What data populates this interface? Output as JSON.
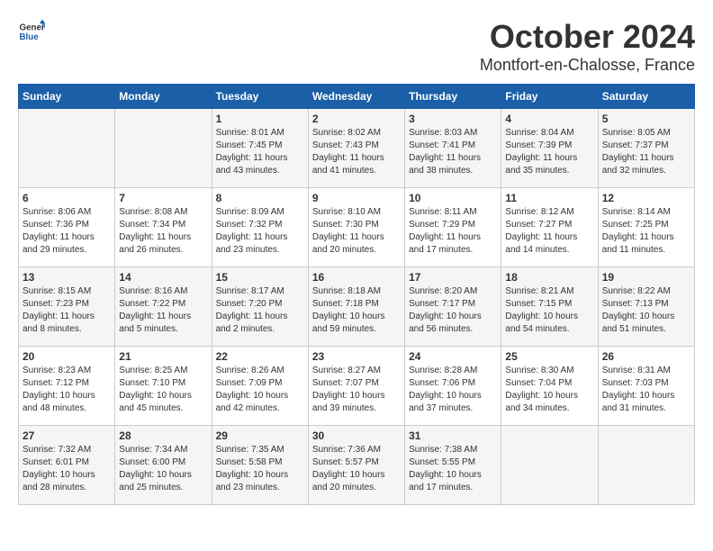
{
  "header": {
    "logo": {
      "general": "General",
      "blue": "Blue"
    },
    "title": "October 2024",
    "location": "Montfort-en-Chalosse, France"
  },
  "days_of_week": [
    "Sunday",
    "Monday",
    "Tuesday",
    "Wednesday",
    "Thursday",
    "Friday",
    "Saturday"
  ],
  "weeks": [
    [
      {
        "day": "",
        "sunrise": "",
        "sunset": "",
        "daylight": ""
      },
      {
        "day": "",
        "sunrise": "",
        "sunset": "",
        "daylight": ""
      },
      {
        "day": "1",
        "sunrise": "Sunrise: 8:01 AM",
        "sunset": "Sunset: 7:45 PM",
        "daylight": "Daylight: 11 hours and 43 minutes."
      },
      {
        "day": "2",
        "sunrise": "Sunrise: 8:02 AM",
        "sunset": "Sunset: 7:43 PM",
        "daylight": "Daylight: 11 hours and 41 minutes."
      },
      {
        "day": "3",
        "sunrise": "Sunrise: 8:03 AM",
        "sunset": "Sunset: 7:41 PM",
        "daylight": "Daylight: 11 hours and 38 minutes."
      },
      {
        "day": "4",
        "sunrise": "Sunrise: 8:04 AM",
        "sunset": "Sunset: 7:39 PM",
        "daylight": "Daylight: 11 hours and 35 minutes."
      },
      {
        "day": "5",
        "sunrise": "Sunrise: 8:05 AM",
        "sunset": "Sunset: 7:37 PM",
        "daylight": "Daylight: 11 hours and 32 minutes."
      }
    ],
    [
      {
        "day": "6",
        "sunrise": "Sunrise: 8:06 AM",
        "sunset": "Sunset: 7:36 PM",
        "daylight": "Daylight: 11 hours and 29 minutes."
      },
      {
        "day": "7",
        "sunrise": "Sunrise: 8:08 AM",
        "sunset": "Sunset: 7:34 PM",
        "daylight": "Daylight: 11 hours and 26 minutes."
      },
      {
        "day": "8",
        "sunrise": "Sunrise: 8:09 AM",
        "sunset": "Sunset: 7:32 PM",
        "daylight": "Daylight: 11 hours and 23 minutes."
      },
      {
        "day": "9",
        "sunrise": "Sunrise: 8:10 AM",
        "sunset": "Sunset: 7:30 PM",
        "daylight": "Daylight: 11 hours and 20 minutes."
      },
      {
        "day": "10",
        "sunrise": "Sunrise: 8:11 AM",
        "sunset": "Sunset: 7:29 PM",
        "daylight": "Daylight: 11 hours and 17 minutes."
      },
      {
        "day": "11",
        "sunrise": "Sunrise: 8:12 AM",
        "sunset": "Sunset: 7:27 PM",
        "daylight": "Daylight: 11 hours and 14 minutes."
      },
      {
        "day": "12",
        "sunrise": "Sunrise: 8:14 AM",
        "sunset": "Sunset: 7:25 PM",
        "daylight": "Daylight: 11 hours and 11 minutes."
      }
    ],
    [
      {
        "day": "13",
        "sunrise": "Sunrise: 8:15 AM",
        "sunset": "Sunset: 7:23 PM",
        "daylight": "Daylight: 11 hours and 8 minutes."
      },
      {
        "day": "14",
        "sunrise": "Sunrise: 8:16 AM",
        "sunset": "Sunset: 7:22 PM",
        "daylight": "Daylight: 11 hours and 5 minutes."
      },
      {
        "day": "15",
        "sunrise": "Sunrise: 8:17 AM",
        "sunset": "Sunset: 7:20 PM",
        "daylight": "Daylight: 11 hours and 2 minutes."
      },
      {
        "day": "16",
        "sunrise": "Sunrise: 8:18 AM",
        "sunset": "Sunset: 7:18 PM",
        "daylight": "Daylight: 10 hours and 59 minutes."
      },
      {
        "day": "17",
        "sunrise": "Sunrise: 8:20 AM",
        "sunset": "Sunset: 7:17 PM",
        "daylight": "Daylight: 10 hours and 56 minutes."
      },
      {
        "day": "18",
        "sunrise": "Sunrise: 8:21 AM",
        "sunset": "Sunset: 7:15 PM",
        "daylight": "Daylight: 10 hours and 54 minutes."
      },
      {
        "day": "19",
        "sunrise": "Sunrise: 8:22 AM",
        "sunset": "Sunset: 7:13 PM",
        "daylight": "Daylight: 10 hours and 51 minutes."
      }
    ],
    [
      {
        "day": "20",
        "sunrise": "Sunrise: 8:23 AM",
        "sunset": "Sunset: 7:12 PM",
        "daylight": "Daylight: 10 hours and 48 minutes."
      },
      {
        "day": "21",
        "sunrise": "Sunrise: 8:25 AM",
        "sunset": "Sunset: 7:10 PM",
        "daylight": "Daylight: 10 hours and 45 minutes."
      },
      {
        "day": "22",
        "sunrise": "Sunrise: 8:26 AM",
        "sunset": "Sunset: 7:09 PM",
        "daylight": "Daylight: 10 hours and 42 minutes."
      },
      {
        "day": "23",
        "sunrise": "Sunrise: 8:27 AM",
        "sunset": "Sunset: 7:07 PM",
        "daylight": "Daylight: 10 hours and 39 minutes."
      },
      {
        "day": "24",
        "sunrise": "Sunrise: 8:28 AM",
        "sunset": "Sunset: 7:06 PM",
        "daylight": "Daylight: 10 hours and 37 minutes."
      },
      {
        "day": "25",
        "sunrise": "Sunrise: 8:30 AM",
        "sunset": "Sunset: 7:04 PM",
        "daylight": "Daylight: 10 hours and 34 minutes."
      },
      {
        "day": "26",
        "sunrise": "Sunrise: 8:31 AM",
        "sunset": "Sunset: 7:03 PM",
        "daylight": "Daylight: 10 hours and 31 minutes."
      }
    ],
    [
      {
        "day": "27",
        "sunrise": "Sunrise: 7:32 AM",
        "sunset": "Sunset: 6:01 PM",
        "daylight": "Daylight: 10 hours and 28 minutes."
      },
      {
        "day": "28",
        "sunrise": "Sunrise: 7:34 AM",
        "sunset": "Sunset: 6:00 PM",
        "daylight": "Daylight: 10 hours and 25 minutes."
      },
      {
        "day": "29",
        "sunrise": "Sunrise: 7:35 AM",
        "sunset": "Sunset: 5:58 PM",
        "daylight": "Daylight: 10 hours and 23 minutes."
      },
      {
        "day": "30",
        "sunrise": "Sunrise: 7:36 AM",
        "sunset": "Sunset: 5:57 PM",
        "daylight": "Daylight: 10 hours and 20 minutes."
      },
      {
        "day": "31",
        "sunrise": "Sunrise: 7:38 AM",
        "sunset": "Sunset: 5:55 PM",
        "daylight": "Daylight: 10 hours and 17 minutes."
      },
      {
        "day": "",
        "sunrise": "",
        "sunset": "",
        "daylight": ""
      },
      {
        "day": "",
        "sunrise": "",
        "sunset": "",
        "daylight": ""
      }
    ]
  ]
}
